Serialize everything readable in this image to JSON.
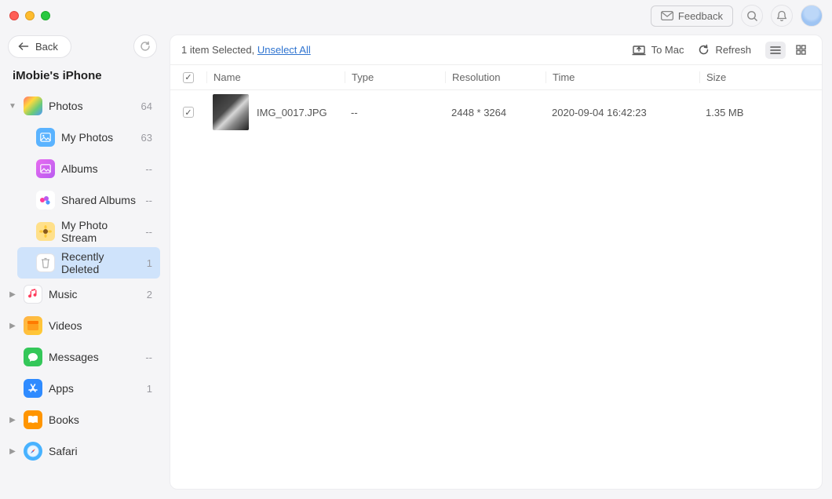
{
  "titlebar": {
    "feedback": "Feedback"
  },
  "sidebar_top": {
    "back": "Back"
  },
  "device_title": "iMobie's iPhone",
  "sidebar": {
    "photos": {
      "label": "Photos",
      "count": "64"
    },
    "my_photos": {
      "label": "My Photos",
      "count": "63"
    },
    "albums": {
      "label": "Albums",
      "count": "--"
    },
    "shared_albums": {
      "label": "Shared Albums",
      "count": "--"
    },
    "photo_stream": {
      "label": "My Photo Stream",
      "count": "--"
    },
    "recently_deleted": {
      "label": "Recently Deleted",
      "count": "1"
    },
    "music": {
      "label": "Music",
      "count": "2"
    },
    "videos": {
      "label": "Videos",
      "count": ""
    },
    "messages": {
      "label": "Messages",
      "count": "--"
    },
    "apps": {
      "label": "Apps",
      "count": "1"
    },
    "books": {
      "label": "Books",
      "count": ""
    },
    "safari": {
      "label": "Safari",
      "count": ""
    }
  },
  "toolbar": {
    "selected_text": "1 item Selected, ",
    "unselect": "Unselect All",
    "to_mac": "To Mac",
    "refresh": "Refresh"
  },
  "columns": {
    "name": "Name",
    "type": "Type",
    "resolution": "Resolution",
    "time": "Time",
    "size": "Size"
  },
  "rows": [
    {
      "name": "IMG_0017.JPG",
      "type": "--",
      "resolution": "2448 * 3264",
      "time": "2020-09-04 16:42:23",
      "size": "1.35 MB",
      "checked": true
    }
  ]
}
